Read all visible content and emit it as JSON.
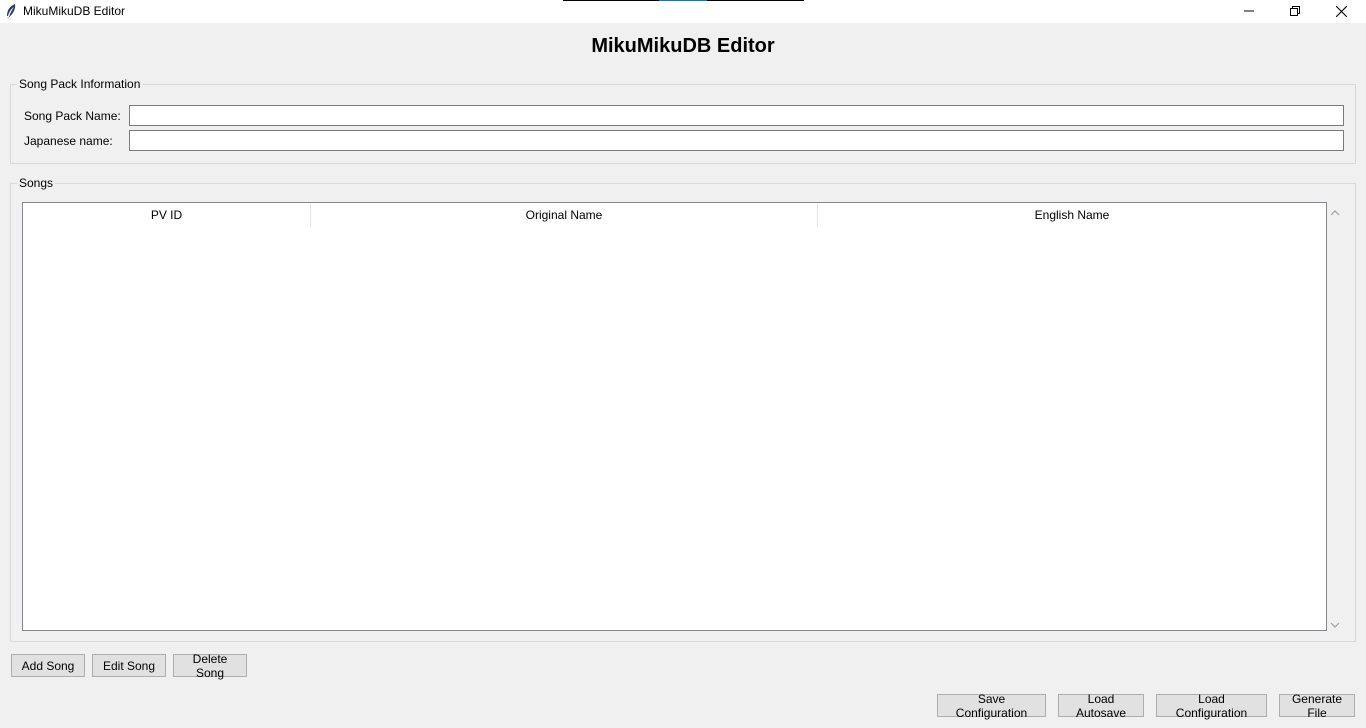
{
  "window": {
    "title": "MikuMikuDB Editor",
    "icon": "feather-icon",
    "controls": [
      "minimize-icon",
      "maximize-icon",
      "close-icon"
    ]
  },
  "heading": "MikuMikuDB Editor",
  "song_pack": {
    "frame_label": "Song Pack Information",
    "name_label": "Song Pack Name:",
    "name_value": "",
    "japanese_label": "Japanese name:",
    "japanese_value": ""
  },
  "songs": {
    "frame_label": "Songs",
    "columns": [
      "PV ID",
      "Original Name",
      "English Name"
    ],
    "rows": []
  },
  "song_buttons": {
    "add": "Add Song",
    "edit": "Edit Song",
    "delete": "Delete Song"
  },
  "footer_buttons": {
    "save_config": "Save Configuration",
    "load_autosave": "Load Autosave",
    "load_config": "Load Configuration",
    "generate": "Generate File"
  },
  "colors": {
    "background": "#f0f0f0",
    "accent": "#0078d7"
  }
}
